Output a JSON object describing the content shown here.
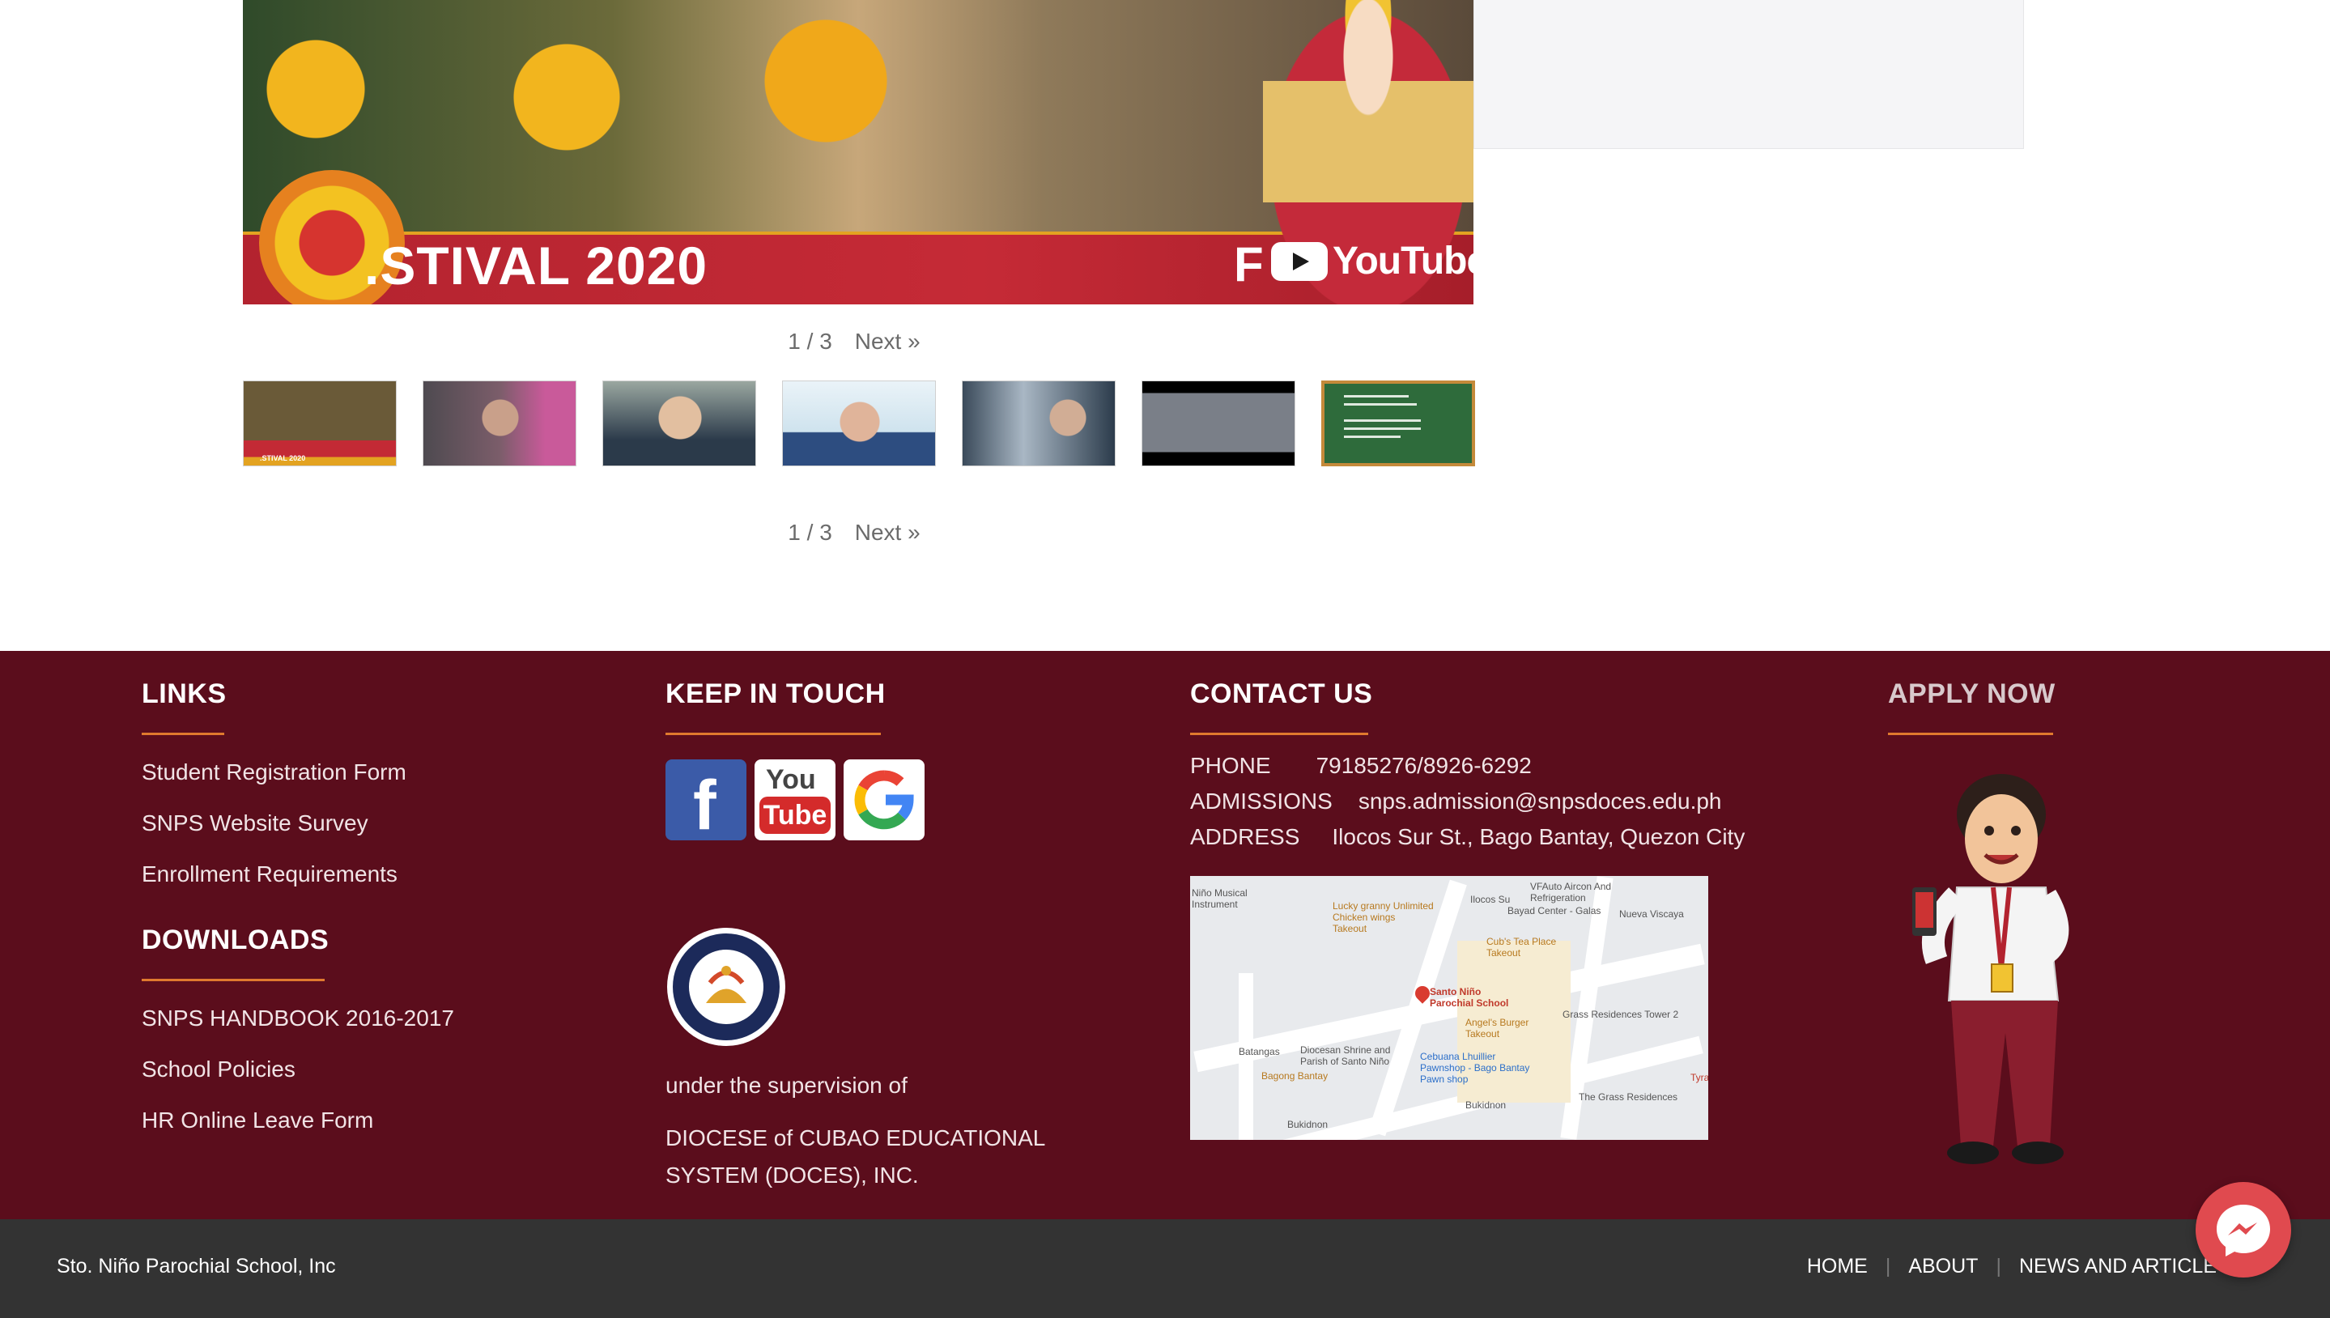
{
  "gallery": {
    "video_title": ".STIVAL 2020",
    "video_letter": "F",
    "youtube_word": "YouTube",
    "pager": {
      "page": "1 / 3",
      "next": "Next »"
    },
    "thumbnails": [
      {
        "name": "festival-2020"
      },
      {
        "name": "teacher-video-1"
      },
      {
        "name": "teacher-video-2"
      },
      {
        "name": "teacher-video-3"
      },
      {
        "name": "teacher-video-4"
      },
      {
        "name": "students-video"
      },
      {
        "name": "registration-info"
      }
    ],
    "thumb7_text": "You will receive an email containing the following: 1. Registration Confirmation 2. Validation Notification of your child/children"
  },
  "footer": {
    "links": {
      "heading": "LINKS",
      "items": [
        "Student Registration Form",
        "SNPS Website Survey",
        "Enrollment Requirements"
      ]
    },
    "downloads": {
      "heading": "DOWNLOADS",
      "items": [
        "SNPS HANDBOOK 2016-2017",
        "School Policies",
        "HR Online Leave Form"
      ]
    },
    "keep_in_touch": {
      "heading": "KEEP IN TOUCH",
      "social": [
        "facebook-icon",
        "youtube-icon",
        "google-icon"
      ],
      "youtube_top": "You",
      "youtube_bottom": "Tube",
      "supervision": "under the supervision of",
      "doces": "DIOCESE of CUBAO EDUCATIONAL SYSTEM (DOCES), INC."
    },
    "contact": {
      "heading": "CONTACT US",
      "phone_label": "PHONE",
      "phone_value": "79185276/8926-6292",
      "admissions_label": "ADMISSIONS",
      "admissions_value": "snps.admission@snpsdoces.edu.ph",
      "address_label": "ADDRESS",
      "address_value": "Ilocos Sur St., Bago Bantay, Quezon City",
      "map_labels": {
        "school": "Santo Niño Parochial School",
        "lucky": "Lucky granny Unlimited Chicken wings",
        "takeout1": "Takeout",
        "cubs": "Cub's Tea Place",
        "takeout2": "Takeout",
        "angels": "Angel's Burger",
        "takeout3": "Takeout",
        "shrine": "Diocesan Shrine and Parish of Santo Niño",
        "pawnshop": "Cebuana Lhuillier Pawnshop - Bago Bantay",
        "pawn": "Pawn shop",
        "bagong": "Bagong Bantay",
        "grass": "Grass Residences Tower 2",
        "nueva": "Nueva Viscaya",
        "bayad": "Bayad Center - Galas",
        "vfauto": "VFAuto Aircon And Refrigeration",
        "nino": "Niño Musical Instrument",
        "bukidnon": "Bukidnon",
        "ilocos": "Ilocos Su",
        "batangas": "Batangas",
        "grass_rd": "The Grass Residences",
        "tyra": "Tyra"
      }
    },
    "apply": {
      "heading": "APPLY NOW"
    }
  },
  "bottombar": {
    "copyright": "Sto. Niño Parochial School, Inc",
    "nav": [
      "HOME",
      "ABOUT",
      "NEWS AND ARTICLE"
    ]
  },
  "colors": {
    "footer_bg": "#5b0d1c",
    "accent_underline": "#e07a2e",
    "bottom_bar": "#333333",
    "messenger": "#e04a4f"
  }
}
